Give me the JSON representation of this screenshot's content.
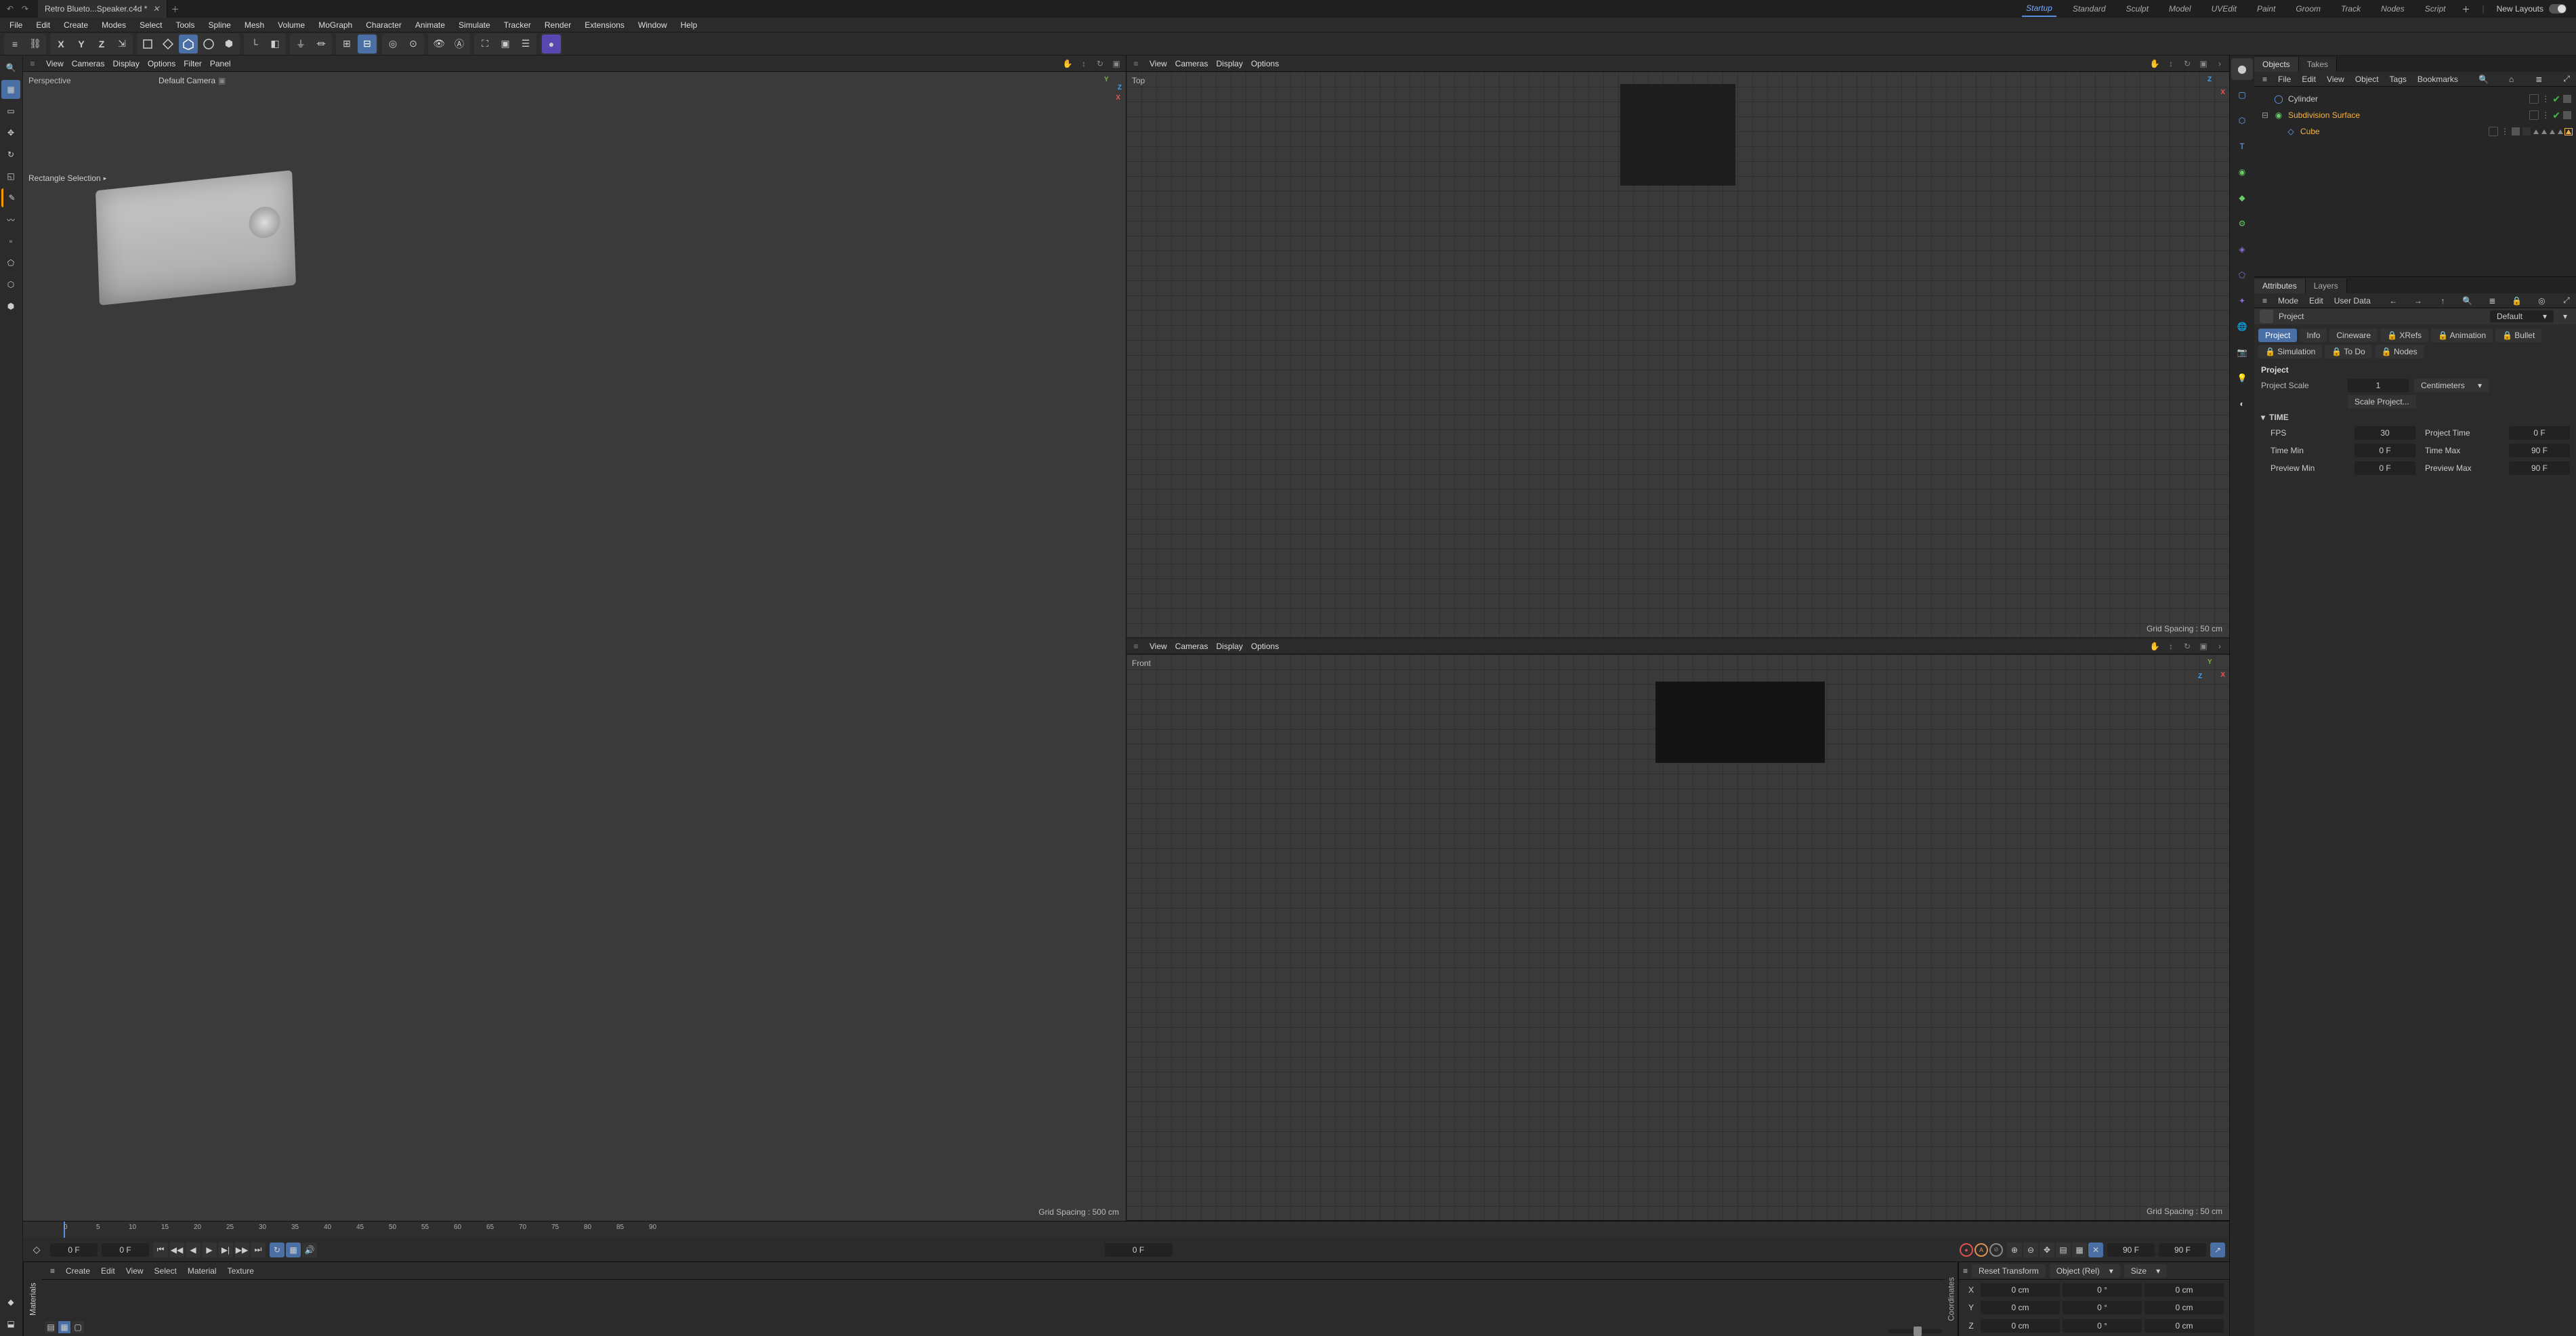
{
  "title_tab": "Retro Blueto...Speaker.c4d *",
  "layouts": [
    "Startup",
    "Standard",
    "Sculpt",
    "Model",
    "UVEdit",
    "Paint",
    "Groom",
    "Track",
    "Nodes",
    "Script"
  ],
  "layouts_active": 0,
  "new_layouts_label": "New Layouts",
  "menubar": [
    "File",
    "Edit",
    "Create",
    "Modes",
    "Select",
    "Tools",
    "Spline",
    "Mesh",
    "Volume",
    "MoGraph",
    "Character",
    "Animate",
    "Simulate",
    "Tracker",
    "Render",
    "Extensions",
    "Window",
    "Help"
  ],
  "viewport_menus": [
    "View",
    "Cameras",
    "Display",
    "Options",
    "Filter",
    "Panel"
  ],
  "viewport_menus_short": [
    "View",
    "Cameras",
    "Display",
    "Options"
  ],
  "perspective": {
    "label": "Perspective",
    "camera": "Default Camera",
    "overlay": "Rectangle Selection",
    "grid": "Grid Spacing : 500 cm"
  },
  "top_view": {
    "label": "Top",
    "grid": "Grid Spacing : 50 cm"
  },
  "front_view": {
    "label": "Front",
    "grid": "Grid Spacing : 50 cm"
  },
  "timeline": {
    "ticks": [
      "0",
      "5",
      "10",
      "15",
      "20",
      "25",
      "30",
      "35",
      "40",
      "45",
      "50",
      "55",
      "60",
      "65",
      "70",
      "75",
      "80",
      "85",
      "90"
    ],
    "cur_frame_a": "0 F",
    "cur_frame_b": "0 F",
    "end_a": "90 F",
    "end_b": "90 F",
    "center_frame": "0 F"
  },
  "materials_panel": {
    "title": "Materials",
    "menus": [
      "Create",
      "Edit",
      "View",
      "Select",
      "Material",
      "Texture"
    ]
  },
  "coord_panel": {
    "side_label": "Coordinates",
    "reset": "Reset Transform",
    "mode": "Object (Rel)",
    "size": "Size",
    "axes": [
      "X",
      "Y",
      "Z"
    ],
    "pos": [
      "0 cm",
      "0 cm",
      "0 cm"
    ],
    "rot": [
      "0 °",
      "0 °",
      "0 °"
    ],
    "scale": [
      "0 cm",
      "0 cm",
      "0 cm"
    ]
  },
  "objects_panel": {
    "tabs": [
      "Objects",
      "Takes"
    ],
    "menus": [
      "File",
      "Edit",
      "View",
      "Object",
      "Tags",
      "Bookmarks"
    ],
    "items": [
      {
        "name": "Cylinder",
        "indent": 0,
        "selected": false,
        "kind": "cylinder"
      },
      {
        "name": "Subdivision Surface",
        "indent": 0,
        "selected": true,
        "kind": "subdiv",
        "expandable": true
      },
      {
        "name": "Cube",
        "indent": 1,
        "selected": true,
        "kind": "cube"
      }
    ]
  },
  "attributes_panel": {
    "tabs": [
      "Attributes",
      "Layers"
    ],
    "menus": [
      "Mode",
      "Edit",
      "User Data"
    ],
    "header_label": "Project",
    "header_dd": "Default",
    "tabset": [
      "Project",
      "Info",
      "Cineware",
      "XRefs",
      "Animation",
      "Bullet",
      "Simulation",
      "To Do",
      "Nodes"
    ],
    "tabset_flags": [
      true,
      false,
      false,
      false,
      false,
      false,
      false,
      false,
      false
    ],
    "tabset_lock": [
      false,
      false,
      false,
      true,
      true,
      true,
      true,
      true,
      true
    ],
    "section_title": "Project",
    "project_scale_label": "Project Scale",
    "project_scale_val": "1",
    "project_scale_unit": "Centimeters",
    "scale_btn": "Scale Project...",
    "time_section": "TIME",
    "time_rows": {
      "fps_l": "FPS",
      "fps_v": "30",
      "ptime_l": "Project Time",
      "ptime_v": "0 F",
      "tmin_l": "Time Min",
      "tmin_v": "0 F",
      "tmax_l": "Time Max",
      "tmax_v": "90 F",
      "pmin_l": "Preview Min",
      "pmin_v": "0 F",
      "pmax_l": "Preview Max",
      "pmax_v": "90 F"
    }
  }
}
